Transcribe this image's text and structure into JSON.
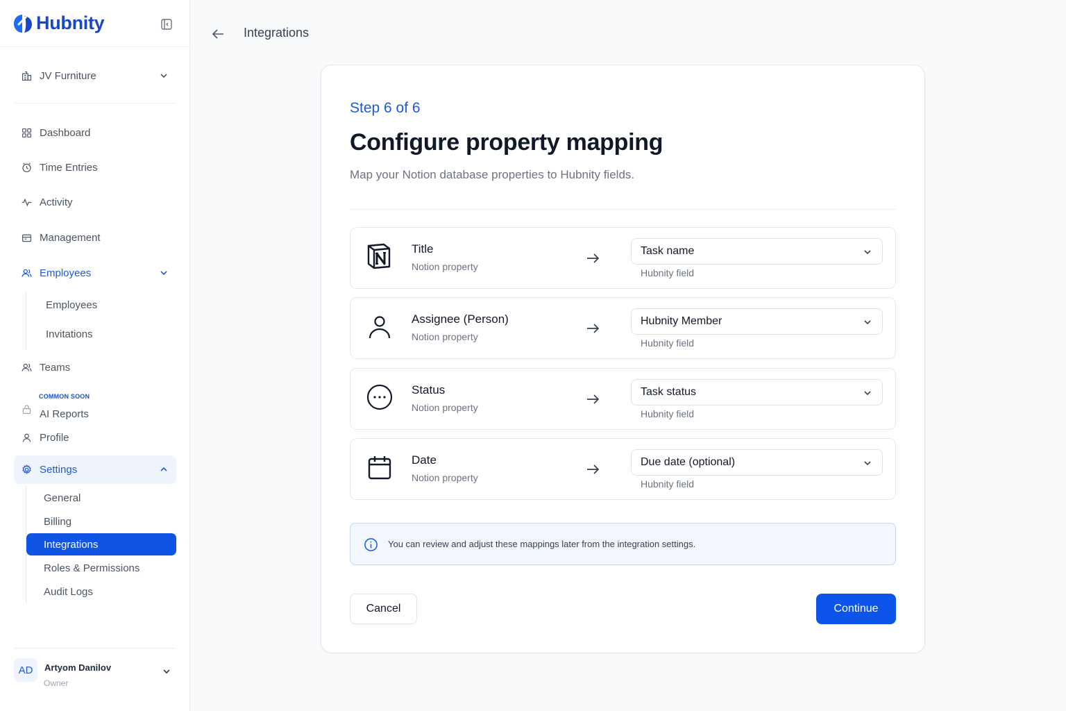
{
  "app": {
    "name": "Hubnity"
  },
  "sidebar": {
    "workspace": "JV Furniture",
    "nav": {
      "dashboard": "Dashboard",
      "time_entries": "Time Entries",
      "activity": "Activity",
      "management": "Management",
      "employees": "Employees",
      "teams": "Teams",
      "ai_reports": "AI Reports",
      "ai_reports_badge": "COMMON SOON",
      "profile": "Profile",
      "settings": "Settings"
    },
    "employees_sub": [
      "Employees",
      "Invitations"
    ],
    "settings_sub": [
      "General",
      "Billing",
      "Integrations",
      "Roles & Permissions",
      "Audit Logs"
    ],
    "user": {
      "initials": "AD",
      "name": "Artyom Danilov",
      "role": "Owner"
    }
  },
  "header": {
    "breadcrumb": "Integrations"
  },
  "wizard": {
    "step": "Step 6 of 6",
    "title": "Configure property mapping",
    "subtitle": "Map your Notion database properties to Hubnity fields.",
    "mappings": [
      {
        "icon": "notion-logo-icon",
        "property": "Title",
        "property_sub": "Notion property",
        "field": "Task name",
        "field_sub": "Hubnity field"
      },
      {
        "icon": "person-icon",
        "property": "Assignee (Person)",
        "property_sub": "Notion property",
        "field": "Hubnity Member",
        "field_sub": "Hubnity field"
      },
      {
        "icon": "status-icon",
        "property": "Status",
        "property_sub": "Notion property",
        "field": "Task status",
        "field_sub": "Hubnity field"
      },
      {
        "icon": "calendar-icon",
        "property": "Date",
        "property_sub": "Notion property",
        "field": "Due date (optional)",
        "field_sub": "Hubnity field"
      }
    ],
    "info": "You can review and adjust these mappings later from the integration settings.",
    "cancel_label": "Cancel",
    "continue_label": "Continue"
  },
  "colors": {
    "accent": "#1054e6",
    "brand": "#1947c8",
    "active_bg": "#eef3fc",
    "info_bg": "#f2f6fd"
  }
}
